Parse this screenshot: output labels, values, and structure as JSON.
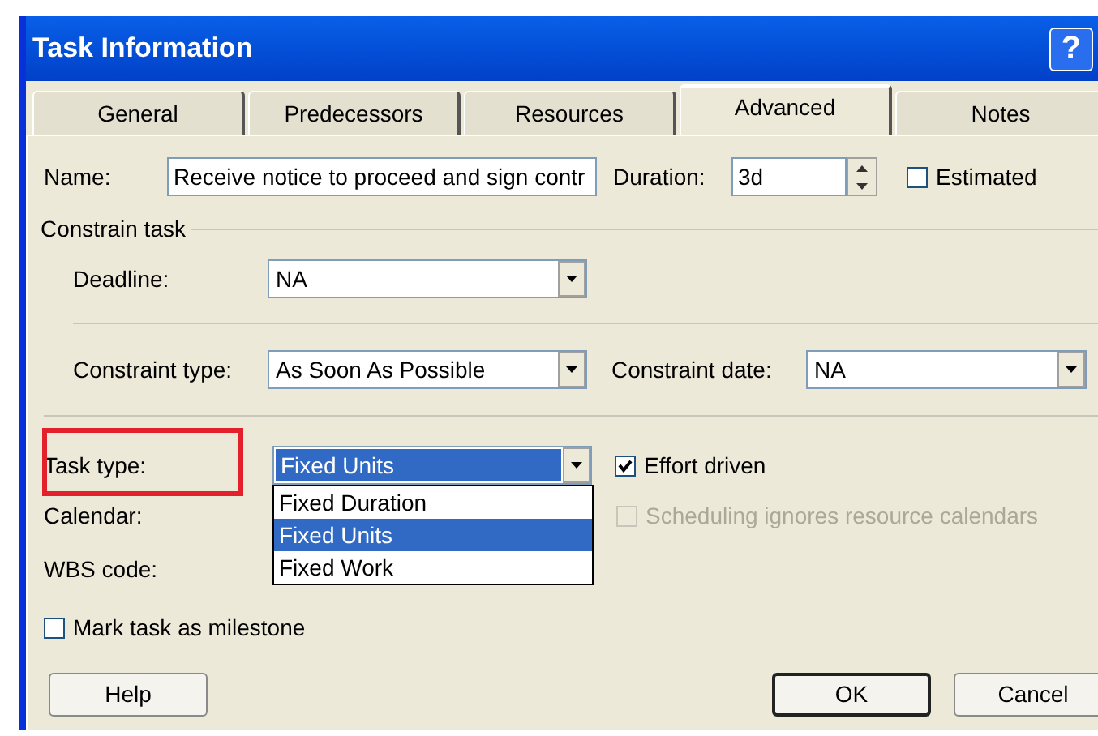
{
  "window": {
    "title": "Task Information",
    "help_button": "?"
  },
  "tabs": [
    {
      "label": "General",
      "selected": false
    },
    {
      "label": "Predecessors",
      "selected": false
    },
    {
      "label": "Resources",
      "selected": false
    },
    {
      "label": "Advanced",
      "selected": true
    },
    {
      "label": "Notes",
      "selected": false
    }
  ],
  "name": {
    "label": "Name:",
    "value": "Receive notice to proceed and sign contr"
  },
  "duration": {
    "label": "Duration:",
    "value": "3d"
  },
  "estimated": {
    "label": "Estimated",
    "checked": false,
    "disabled": false
  },
  "constrain_task": {
    "title": "Constrain task",
    "deadline": {
      "label": "Deadline:",
      "value": "NA"
    },
    "constraint_type": {
      "label": "Constraint type:",
      "value": "As Soon As Possible"
    },
    "constraint_date": {
      "label": "Constraint date:",
      "value": "NA"
    }
  },
  "task_type": {
    "label": "Task type:",
    "value": "Fixed Units",
    "highlighted": true,
    "expanded": true,
    "options": [
      {
        "label": "Fixed Duration",
        "selected": false
      },
      {
        "label": "Fixed Units",
        "selected": true
      },
      {
        "label": "Fixed Work",
        "selected": false
      }
    ]
  },
  "effort_driven": {
    "label": "Effort driven",
    "checked": true,
    "disabled": false
  },
  "calendar": {
    "label": "Calendar:"
  },
  "scheduling_ignores": {
    "label": "Scheduling ignores resource calendars",
    "checked": false,
    "disabled": true
  },
  "wbs_code": {
    "label": "WBS code:"
  },
  "milestone": {
    "label": "Mark task as milestone",
    "checked": false,
    "disabled": false
  },
  "buttons": [
    {
      "label": "Help",
      "default": false
    },
    {
      "label": "OK",
      "default": true
    },
    {
      "label": "Cancel",
      "default": false
    }
  ]
}
